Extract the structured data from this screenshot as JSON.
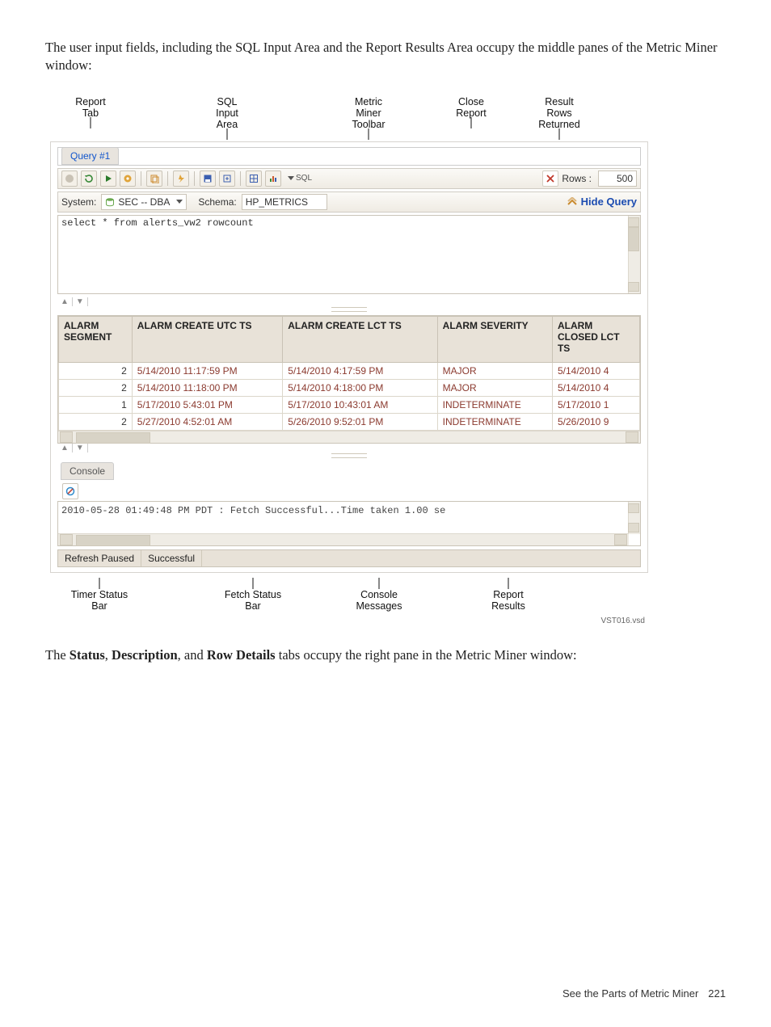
{
  "intro": "The user input fields, including the SQL Input Area and the Report Results Area occupy the middle panes of the Metric Miner window:",
  "callouts_top": {
    "report_tab": "Report\nTab",
    "sql_input_area": "SQL\nInput\nArea",
    "metric_toolbar": "Metric\nMiner\nToolbar",
    "close_report": "Close\nReport",
    "result_rows": "Result\nRows\nReturned"
  },
  "tab": {
    "label": "Query #1"
  },
  "toolbar": {
    "rows_label": "Rows :",
    "rows_value": "500",
    "sql_label": "SQL"
  },
  "toolbar2": {
    "system_label": "System:",
    "system_value": "SEC -- DBA",
    "schema_label": "Schema:",
    "schema_value": "HP_METRICS",
    "hide_query": "Hide Query"
  },
  "sql_text": "select * from alerts_vw2 rowcount",
  "small_tabs": [
    "▲",
    "▼"
  ],
  "columns": [
    "ALARM SEGMENT",
    "ALARM CREATE UTC TS",
    "ALARM CREATE LCT TS",
    "ALARM SEVERITY",
    "ALARM CLOSED LCT TS"
  ],
  "rows": [
    {
      "seg": "2",
      "cutc": "5/14/2010 11:17:59 PM",
      "clct": "5/14/2010 4:17:59 PM",
      "sev": "MAJOR",
      "closed": "5/14/2010 4"
    },
    {
      "seg": "2",
      "cutc": "5/14/2010 11:18:00 PM",
      "clct": "5/14/2010 4:18:00 PM",
      "sev": "MAJOR",
      "closed": "5/14/2010 4"
    },
    {
      "seg": "1",
      "cutc": "5/17/2010 5:43:01 PM",
      "clct": "5/17/2010 10:43:01 AM",
      "sev": "INDETERMINATE",
      "closed": "5/17/2010 1"
    },
    {
      "seg": "2",
      "cutc": "5/27/2010 4:52:01 AM",
      "clct": "5/26/2010 9:52:01 PM",
      "sev": "INDETERMINATE",
      "closed": "5/26/2010 9"
    }
  ],
  "console_tab": "Console",
  "console_text": "2010-05-28 01:49:48 PM PDT : Fetch Successful...Time taken 1.00 se",
  "status": {
    "refresh": "Refresh Paused",
    "fetch": "Successful"
  },
  "callouts_bottom": {
    "timer": "Timer Status\nBar",
    "fetch": "Fetch Status\nBar",
    "console": "Console\nMessages",
    "report": "Report\nResults"
  },
  "vsd": "VST016.vsd",
  "outro_pre": "The ",
  "outro_b1": "Status",
  "outro_mid1": ", ",
  "outro_b2": "Description",
  "outro_mid2": ", and ",
  "outro_b3": "Row Details",
  "outro_post": " tabs occupy the right pane in the Metric Miner window:",
  "footer": {
    "text": "See the Parts of Metric Miner",
    "page": "221"
  }
}
